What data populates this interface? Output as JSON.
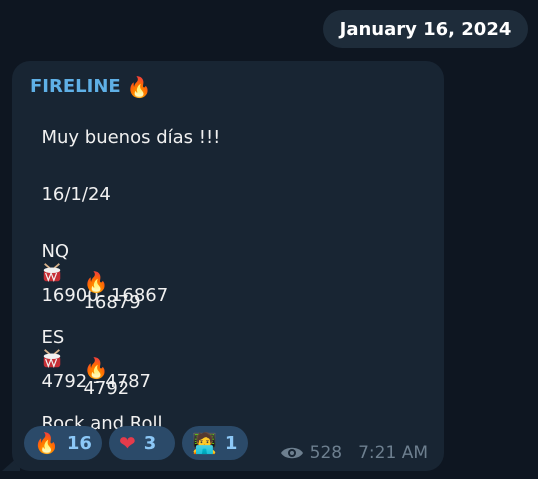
{
  "date_pill": "January 16, 2024",
  "message": {
    "sender": "FIRELINE",
    "sender_emoji": "🔥",
    "lines": {
      "greeting": "Muy buenos días !!!",
      "date": "16/1/24",
      "nq_prefix": "NQ",
      "nq_range": "16900- 16867",
      "nq_fire": "16879",
      "es_prefix": "ES",
      "es_range": "4792 - 4787",
      "es_fire": "4792",
      "closing": "Rock and Roll"
    }
  },
  "reactions": [
    {
      "emoji": "🔥",
      "count": "16"
    },
    {
      "emoji": "❤",
      "count": "3"
    },
    {
      "emoji": "🧑‍💻",
      "count": "1"
    }
  ],
  "views": "528",
  "time": "7:21 AM",
  "colors": {
    "background": "#0e1621",
    "bubble": "#182533",
    "sender": "#5fb0e6",
    "reaction_bg": "#2b4a69",
    "reaction_text": "#8cc8f7"
  }
}
